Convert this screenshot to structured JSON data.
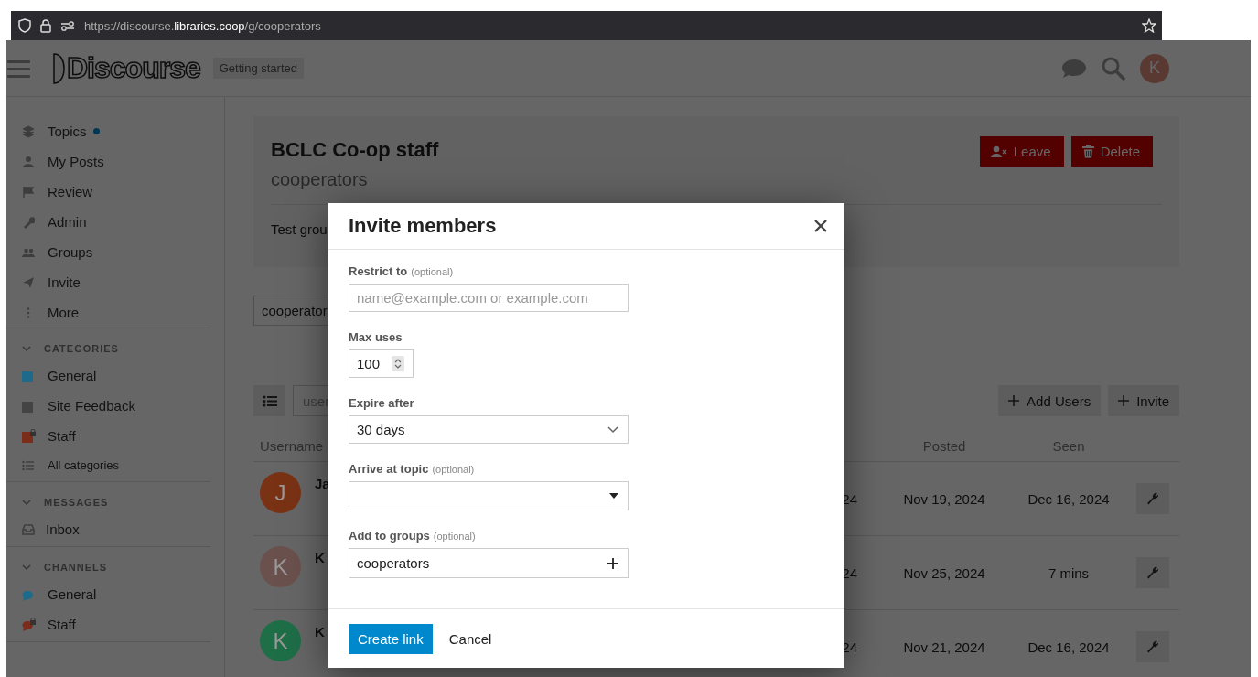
{
  "browser": {
    "url": "https://discourse.**libraries.coop**/g/cooperators"
  },
  "header": {
    "logo": "Discourse",
    "badge": "Getting started",
    "avatar_letter": "K"
  },
  "sidebar": {
    "items": [
      {
        "label": "Topics",
        "new_indicator": true
      },
      {
        "label": "My Posts",
        "new_indicator": false
      },
      {
        "label": "Review",
        "new_indicator": false
      },
      {
        "label": "Admin",
        "new_indicator": false
      },
      {
        "label": "Groups",
        "new_indicator": false
      },
      {
        "label": "Invite",
        "new_indicator": false
      },
      {
        "label": "More",
        "new_indicator": false
      }
    ],
    "sections": [
      {
        "title": "CATEGORIES",
        "expanded": true,
        "items": [
          {
            "kind": "category",
            "label": "General",
            "color": "#1d6a8a",
            "locked": false
          },
          {
            "kind": "category",
            "label": "Site Feedback",
            "color": "#444444",
            "locked": false
          },
          {
            "kind": "category",
            "label": "Staff",
            "color": "#7a2e1a",
            "locked": true
          },
          {
            "kind": "all",
            "label": "All categories",
            "locked": false
          }
        ]
      },
      {
        "title": "MESSAGES",
        "expanded": true,
        "items": [
          {
            "kind": "inbox",
            "label": "Inbox",
            "locked": false
          }
        ]
      },
      {
        "title": "CHANNELS",
        "expanded": true,
        "items": [
          {
            "kind": "channel",
            "label": "General",
            "color": "#1c6a8c",
            "locked": false
          },
          {
            "kind": "channel",
            "label": "Staff",
            "color": "#7a2e1a",
            "locked": true
          }
        ]
      }
    ]
  },
  "group": {
    "title": "BCLC Co-op staff",
    "name": "cooperators",
    "description": "Test grou",
    "buttons": [
      {
        "kind": "leave",
        "label": "Leave"
      },
      {
        "kind": "delete",
        "label": "Delete"
      }
    ],
    "selector": "cooperator",
    "filter_placeholder": "user",
    "actions": [
      {
        "label": "Add Users"
      },
      {
        "label": "Invite"
      }
    ],
    "columns": {
      "username": "Username",
      "posted": "Posted",
      "seen": "Seen"
    },
    "rows": [
      {
        "avatar_letter": "J",
        "color": "#7a3215",
        "name": "Ja",
        "column_3": "24",
        "posted": "Nov 19, 2024",
        "seen": "Dec 16, 2024"
      },
      {
        "avatar_letter": "K",
        "color": "#6b514d",
        "name": "K",
        "column_3": "24",
        "posted": "Nov 25, 2024",
        "seen": "7 mins"
      },
      {
        "avatar_letter": "K",
        "color": "#1e6e48",
        "name": "K",
        "column_3": "24",
        "posted": "Nov 21, 2024",
        "seen": "Dec 16, 2024"
      }
    ]
  },
  "modal": {
    "title": "Invite members",
    "fields": [
      {
        "kind": "text",
        "label": "Restrict to",
        "hint": "(optional)",
        "placeholder": "name@example.com or example.com"
      },
      {
        "kind": "number",
        "label": "Max uses",
        "value": "100"
      },
      {
        "kind": "select",
        "label": "Expire after",
        "value": "30 days"
      },
      {
        "kind": "combo",
        "label": "Arrive at topic",
        "hint": "(optional)"
      },
      {
        "kind": "group",
        "label": "Add to groups",
        "hint": "(optional)",
        "value": "cooperators"
      }
    ],
    "buttons": [
      {
        "kind": "primary",
        "label": "Create link"
      },
      {
        "kind": "flat",
        "label": "Cancel"
      }
    ]
  }
}
